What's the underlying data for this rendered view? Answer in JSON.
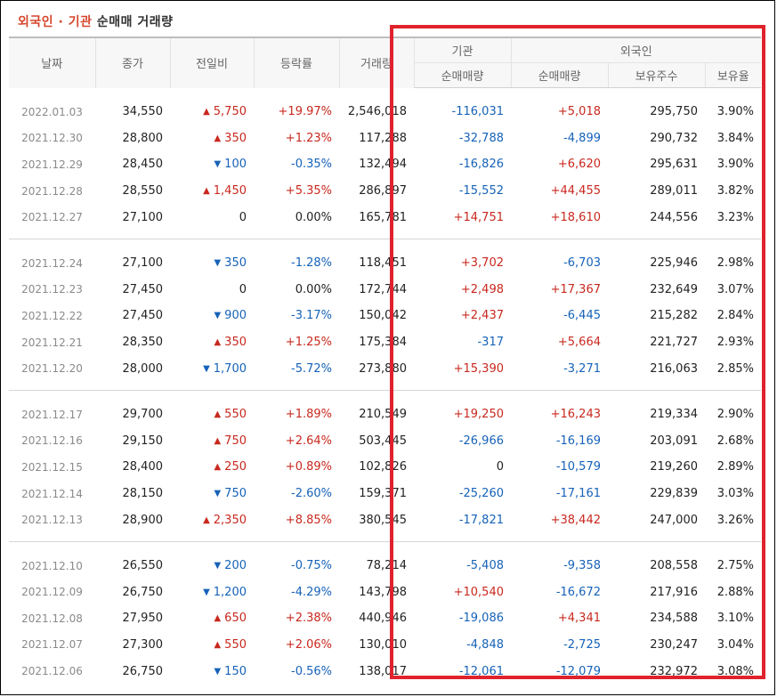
{
  "title": {
    "accent": "외국인 · 기관",
    "rest": " 순매매 거래량"
  },
  "header": {
    "date": "날짜",
    "close": "종가",
    "change": "전일비",
    "rate": "등락률",
    "volume": "거래량",
    "institution": "기관",
    "foreign": "외국인",
    "inst_net": "순매매량",
    "frgn_net": "순매매량",
    "frgn_hold": "보유주수",
    "frgn_ratio": "보유율"
  },
  "colors": {
    "up": "#c8281e",
    "down": "#1662b8",
    "highlight": "#e0222c",
    "title_accent": "#d5462c"
  },
  "icons": {
    "up": "red-up-triangle-icon",
    "down": "blue-down-triangle-icon"
  },
  "groups": [
    [
      {
        "date": "2022.01.03",
        "close": "34,550",
        "dir": "up",
        "change": "5,750",
        "rate": "+19.97%",
        "volume": "2,546,018",
        "inst": "-116,031",
        "frgn": "+5,018",
        "hold": "295,750",
        "ratio": "3.90%"
      },
      {
        "date": "2021.12.30",
        "close": "28,800",
        "dir": "up",
        "change": "350",
        "rate": "+1.23%",
        "volume": "117,288",
        "inst": "-32,788",
        "frgn": "-4,899",
        "hold": "290,732",
        "ratio": "3.84%"
      },
      {
        "date": "2021.12.29",
        "close": "28,450",
        "dir": "down",
        "change": "100",
        "rate": "-0.35%",
        "volume": "132,494",
        "inst": "-16,826",
        "frgn": "+6,620",
        "hold": "295,631",
        "ratio": "3.90%"
      },
      {
        "date": "2021.12.28",
        "close": "28,550",
        "dir": "up",
        "change": "1,450",
        "rate": "+5.35%",
        "volume": "286,897",
        "inst": "-15,552",
        "frgn": "+44,455",
        "hold": "289,011",
        "ratio": "3.82%"
      },
      {
        "date": "2021.12.27",
        "close": "27,100",
        "dir": "none",
        "change": "0",
        "rate": "0.00%",
        "volume": "165,781",
        "inst": "+14,751",
        "frgn": "+18,610",
        "hold": "244,556",
        "ratio": "3.23%"
      }
    ],
    [
      {
        "date": "2021.12.24",
        "close": "27,100",
        "dir": "down",
        "change": "350",
        "rate": "-1.28%",
        "volume": "118,451",
        "inst": "+3,702",
        "frgn": "-6,703",
        "hold": "225,946",
        "ratio": "2.98%"
      },
      {
        "date": "2021.12.23",
        "close": "27,450",
        "dir": "none",
        "change": "0",
        "rate": "0.00%",
        "volume": "172,744",
        "inst": "+2,498",
        "frgn": "+17,367",
        "hold": "232,649",
        "ratio": "3.07%"
      },
      {
        "date": "2021.12.22",
        "close": "27,450",
        "dir": "down",
        "change": "900",
        "rate": "-3.17%",
        "volume": "150,042",
        "inst": "+2,437",
        "frgn": "-6,445",
        "hold": "215,282",
        "ratio": "2.84%"
      },
      {
        "date": "2021.12.21",
        "close": "28,350",
        "dir": "up",
        "change": "350",
        "rate": "+1.25%",
        "volume": "175,384",
        "inst": "-317",
        "frgn": "+5,664",
        "hold": "221,727",
        "ratio": "2.93%"
      },
      {
        "date": "2021.12.20",
        "close": "28,000",
        "dir": "down",
        "change": "1,700",
        "rate": "-5.72%",
        "volume": "273,880",
        "inst": "+15,390",
        "frgn": "-3,271",
        "hold": "216,063",
        "ratio": "2.85%"
      }
    ],
    [
      {
        "date": "2021.12.17",
        "close": "29,700",
        "dir": "up",
        "change": "550",
        "rate": "+1.89%",
        "volume": "210,549",
        "inst": "+19,250",
        "frgn": "+16,243",
        "hold": "219,334",
        "ratio": "2.90%"
      },
      {
        "date": "2021.12.16",
        "close": "29,150",
        "dir": "up",
        "change": "750",
        "rate": "+2.64%",
        "volume": "503,445",
        "inst": "-26,966",
        "frgn": "-16,169",
        "hold": "203,091",
        "ratio": "2.68%"
      },
      {
        "date": "2021.12.15",
        "close": "28,400",
        "dir": "up",
        "change": "250",
        "rate": "+0.89%",
        "volume": "102,826",
        "inst": "0",
        "frgn": "-10,579",
        "hold": "219,260",
        "ratio": "2.89%"
      },
      {
        "date": "2021.12.14",
        "close": "28,150",
        "dir": "down",
        "change": "750",
        "rate": "-2.60%",
        "volume": "159,371",
        "inst": "-25,260",
        "frgn": "-17,161",
        "hold": "229,839",
        "ratio": "3.03%"
      },
      {
        "date": "2021.12.13",
        "close": "28,900",
        "dir": "up",
        "change": "2,350",
        "rate": "+8.85%",
        "volume": "380,545",
        "inst": "-17,821",
        "frgn": "+38,442",
        "hold": "247,000",
        "ratio": "3.26%"
      }
    ],
    [
      {
        "date": "2021.12.10",
        "close": "26,550",
        "dir": "down",
        "change": "200",
        "rate": "-0.75%",
        "volume": "78,214",
        "inst": "-5,408",
        "frgn": "-9,358",
        "hold": "208,558",
        "ratio": "2.75%"
      },
      {
        "date": "2021.12.09",
        "close": "26,750",
        "dir": "down",
        "change": "1,200",
        "rate": "-4.29%",
        "volume": "143,798",
        "inst": "+10,540",
        "frgn": "-16,672",
        "hold": "217,916",
        "ratio": "2.88%"
      },
      {
        "date": "2021.12.08",
        "close": "27,950",
        "dir": "up",
        "change": "650",
        "rate": "+2.38%",
        "volume": "440,946",
        "inst": "-19,086",
        "frgn": "+4,341",
        "hold": "234,588",
        "ratio": "3.10%"
      },
      {
        "date": "2021.12.07",
        "close": "27,300",
        "dir": "up",
        "change": "550",
        "rate": "+2.06%",
        "volume": "130,010",
        "inst": "-4,848",
        "frgn": "-2,725",
        "hold": "230,247",
        "ratio": "3.04%"
      },
      {
        "date": "2021.12.06",
        "close": "26,750",
        "dir": "down",
        "change": "150",
        "rate": "-0.56%",
        "volume": "138,017",
        "inst": "-12,061",
        "frgn": "-12,079",
        "hold": "232,972",
        "ratio": "3.08%"
      }
    ]
  ]
}
